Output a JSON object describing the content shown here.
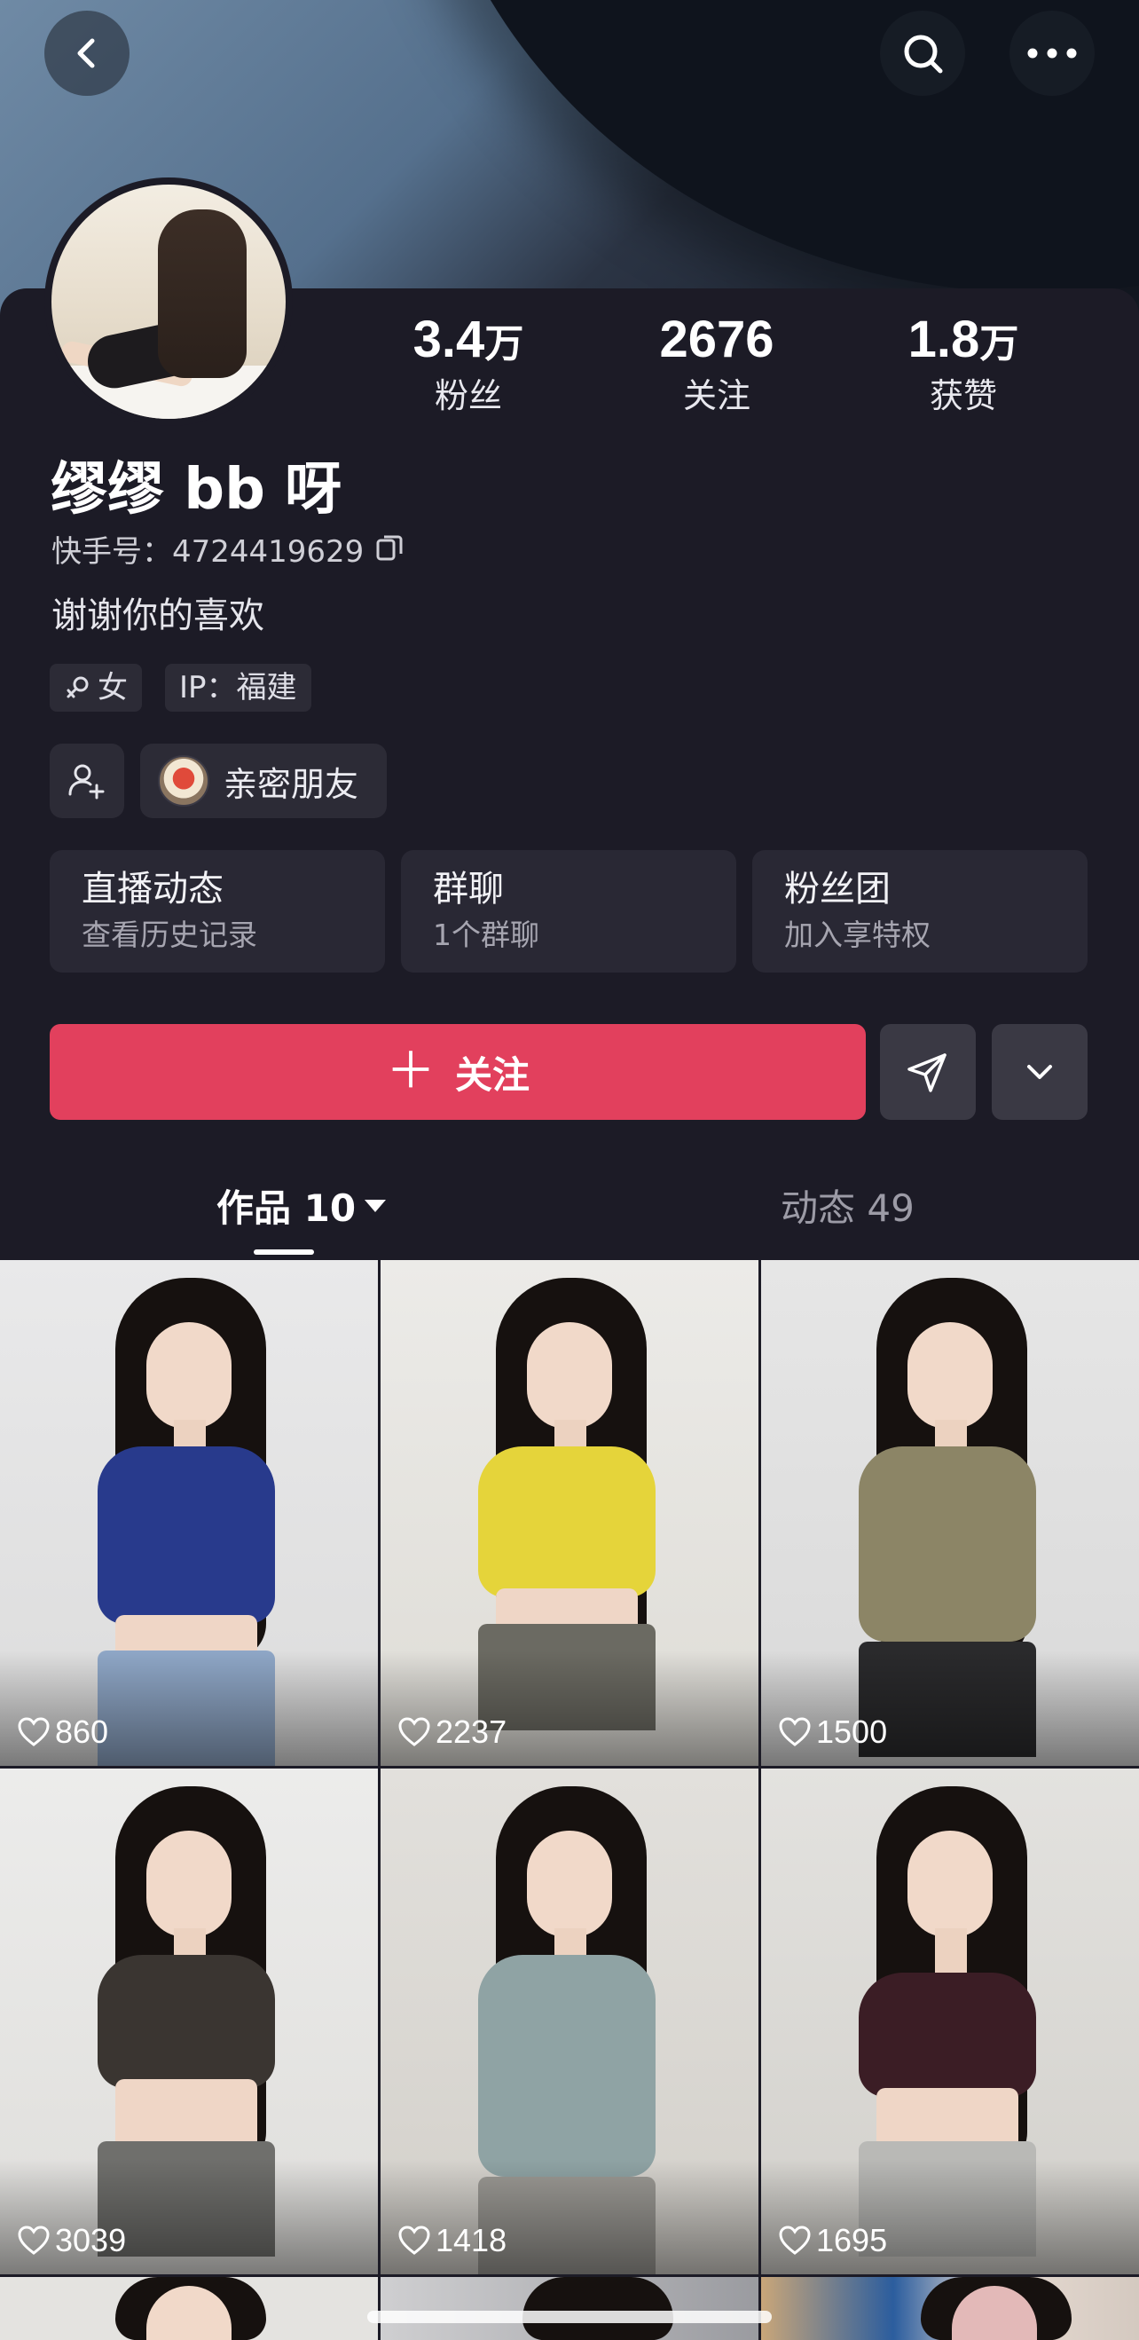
{
  "header": {
    "back_icon": "chevron-left-icon",
    "search_icon": "search-icon",
    "more_icon": "more-horizontal-icon"
  },
  "profile": {
    "name": "缪缪 bb 呀",
    "id_text": "快手号：4724419629",
    "bio": "谢谢你的喜欢",
    "gender_tag": "女",
    "ip_tag": "IP：福建",
    "friend_label": "亲密朋友"
  },
  "stats": [
    {
      "value": "3.4",
      "unit": "万",
      "label": "粉丝"
    },
    {
      "value": "2676",
      "unit": "",
      "label": "关注"
    },
    {
      "value": "1.8",
      "unit": "万",
      "label": "获赞"
    }
  ],
  "features": [
    {
      "title": "直播动态",
      "subtitle": "查看历史记录"
    },
    {
      "title": "群聊",
      "subtitle": "1个群聊"
    },
    {
      "title": "粉丝团",
      "subtitle": "加入享特权"
    }
  ],
  "actions": {
    "follow_label": "关注",
    "follow_color": "#e2405d"
  },
  "tabs": {
    "works": "作品 10",
    "moments": "动态 49"
  },
  "videos": [
    {
      "likes": "860"
    },
    {
      "likes": "2237"
    },
    {
      "likes": "1500"
    },
    {
      "likes": "3039"
    },
    {
      "likes": "1418"
    },
    {
      "likes": "1695"
    }
  ]
}
